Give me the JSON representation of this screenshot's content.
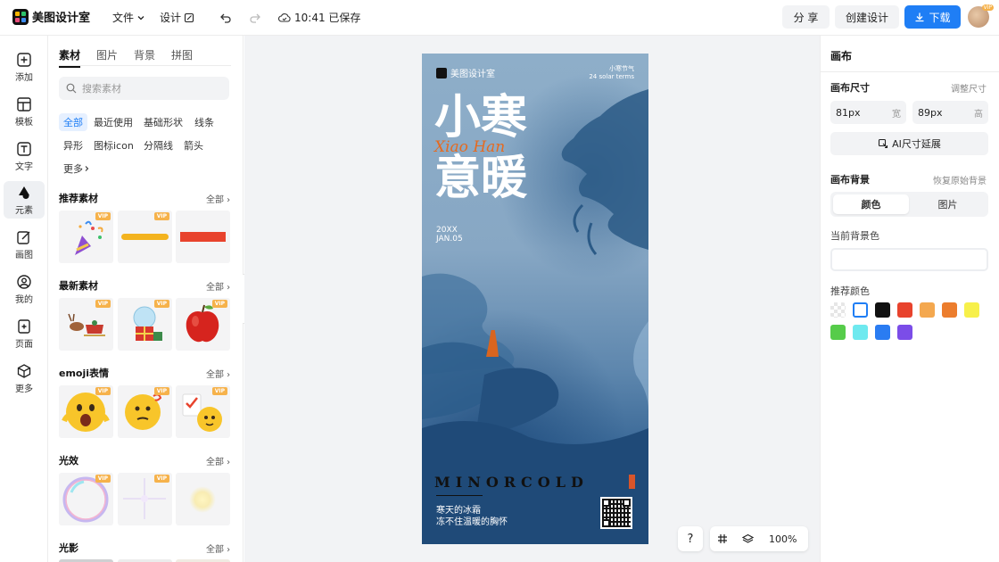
{
  "app": {
    "name": "美图设计室"
  },
  "topbar": {
    "file_menu": "文件",
    "design_menu": "设计",
    "save_status": "10:41 已保存",
    "share_label": "分 享",
    "create_label": "创建设计",
    "download_label": "下载",
    "avatar_badge": "VIP"
  },
  "rail": {
    "items": [
      {
        "label": "添加",
        "icon": "plus-square-icon"
      },
      {
        "label": "模板",
        "icon": "template-icon"
      },
      {
        "label": "文字",
        "icon": "text-icon"
      },
      {
        "label": "元素",
        "icon": "element-icon"
      },
      {
        "label": "画图",
        "icon": "draw-icon"
      },
      {
        "label": "我的",
        "icon": "user-icon"
      },
      {
        "label": "页面",
        "icon": "page-icon"
      },
      {
        "label": "更多",
        "icon": "cube-icon"
      }
    ]
  },
  "assets": {
    "tabs": [
      "素材",
      "图片",
      "背景",
      "拼图"
    ],
    "search_placeholder": "搜索素材",
    "chips": [
      "全部",
      "最近使用",
      "基础形状",
      "线条",
      "异形",
      "图标icon",
      "分隔线",
      "箭头",
      "更多"
    ],
    "vip_badge": "VIP",
    "sections": [
      {
        "title": "推荐素材",
        "all": "全部"
      },
      {
        "title": "最新素材",
        "all": "全部"
      },
      {
        "title": "emoji表情",
        "all": "全部"
      },
      {
        "title": "光效",
        "all": "全部"
      },
      {
        "title": "光影",
        "all": "全部"
      }
    ]
  },
  "poster": {
    "brand": "美图设计室",
    "date_line1": "小寒节气",
    "date_line2": "24 solar terms",
    "title_line1": "小寒",
    "title_line2": "意暖",
    "script": "Xiao Han",
    "year": "20XX",
    "month_day": "JAN.05",
    "en_title": "MINORCOLD",
    "cn_line1": "寒天的冰霜",
    "cn_line2": "冻不住温暖的胸怀"
  },
  "zoom": {
    "help": "?",
    "value": "100%"
  },
  "right_panel": {
    "title": "画布",
    "size_label": "画布尺寸",
    "adjust_size": "调整尺寸",
    "width_value": "81px",
    "width_unit": "宽",
    "height_value": "89px",
    "height_unit": "高",
    "ai_extend": "AI尺寸延展",
    "bg_label": "画布背景",
    "restore_bg": "恢复原始背景",
    "seg_color": "颜色",
    "seg_image": "图片",
    "current_bg": "当前背景色",
    "recommended": "推荐颜色",
    "swatches": [
      "transparent",
      "#ffffff",
      "#111111",
      "#e8432d",
      "#f4a84f",
      "#ec7d2d",
      "#f7f04a",
      "#56cc4a",
      "#6ee9ef",
      "#2a7cf2",
      "#7b4de8"
    ]
  }
}
